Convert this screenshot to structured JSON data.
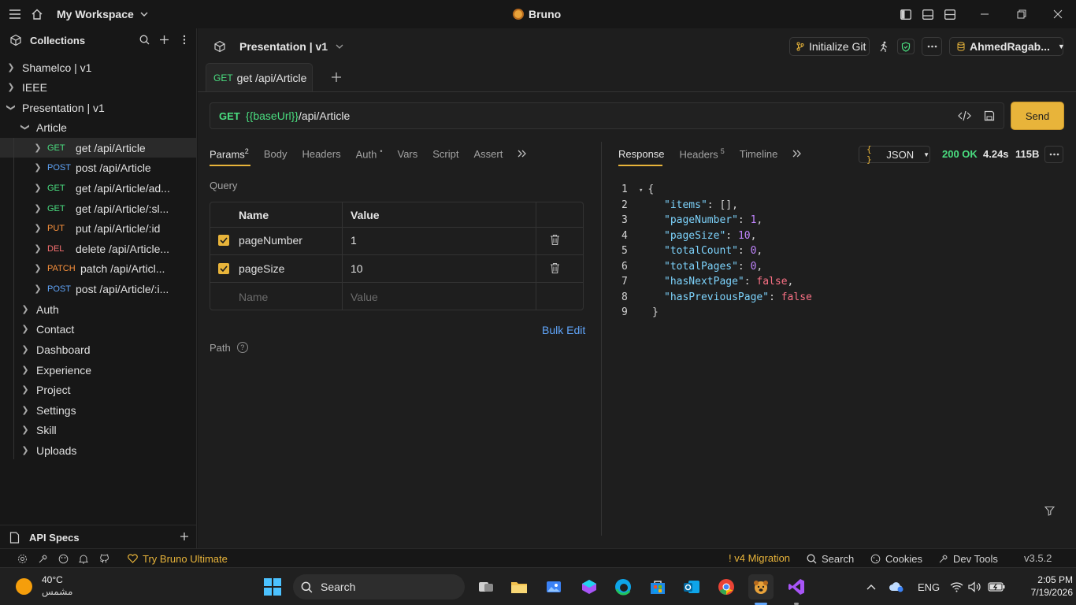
{
  "titlebar": {
    "workspace": "My Workspace",
    "app_name": "Bruno"
  },
  "sidebar": {
    "title": "Collections",
    "collections": [
      {
        "name": "Shamelco | v1",
        "expanded": false
      },
      {
        "name": "IEEE",
        "expanded": false
      },
      {
        "name": "Presentation | v1",
        "expanded": true
      }
    ],
    "folder_open": "Article",
    "requests": [
      {
        "method": "GET",
        "name": "get /api/Article"
      },
      {
        "method": "POST",
        "name": "post /api/Article"
      },
      {
        "method": "GET",
        "name": "get /api/Article/ad..."
      },
      {
        "method": "GET",
        "name": "get /api/Article/:sl..."
      },
      {
        "method": "PUT",
        "name": "put /api/Article/:id"
      },
      {
        "method": "DEL",
        "name": "delete /api/Article..."
      },
      {
        "method": "PATCH",
        "name": "patch /api/Articl..."
      },
      {
        "method": "POST",
        "name": "post /api/Article/:i..."
      }
    ],
    "folders": [
      "Auth",
      "Contact",
      "Dashboard",
      "Experience",
      "Project",
      "Settings",
      "Skill",
      "Uploads"
    ],
    "api_specs": "API Specs"
  },
  "header": {
    "collection_title": "Presentation | v1",
    "init_git": "Initialize Git",
    "environment": "AhmedRagab..."
  },
  "request_tab": {
    "method": "GET",
    "name": "get /api/Article"
  },
  "url_bar": {
    "method": "GET",
    "var": "{{baseUrl}}",
    "path": "/api/Article",
    "send": "Send"
  },
  "request_tabs": [
    {
      "label": "Params",
      "sup": "2"
    },
    {
      "label": "Body",
      "sup": ""
    },
    {
      "label": "Headers",
      "sup": ""
    },
    {
      "label": "Auth",
      "sup": "•"
    },
    {
      "label": "Vars",
      "sup": ""
    },
    {
      "label": "Script",
      "sup": ""
    },
    {
      "label": "Assert",
      "sup": ""
    }
  ],
  "params": {
    "query_label": "Query",
    "col_name": "Name",
    "col_value": "Value",
    "rows": [
      {
        "name": "pageNumber",
        "value": "1"
      },
      {
        "name": "pageSize",
        "value": "10"
      }
    ],
    "placeholder_name": "Name",
    "placeholder_value": "Value",
    "bulk_edit": "Bulk Edit",
    "path_label": "Path"
  },
  "response": {
    "tabs": [
      {
        "label": "Response",
        "sup": ""
      },
      {
        "label": "Headers",
        "sup": "5"
      },
      {
        "label": "Timeline",
        "sup": ""
      }
    ],
    "format": "JSON",
    "status": "200 OK",
    "time": "4.24s",
    "size": "115B",
    "lines": [
      {
        "n": "1",
        "key": "",
        "val": "{",
        "type": "p"
      },
      {
        "n": "2",
        "key": "\"items\"",
        "val": "[]",
        "type": "p"
      },
      {
        "n": "3",
        "key": "\"pageNumber\"",
        "val": "1",
        "type": "n"
      },
      {
        "n": "4",
        "key": "\"pageSize\"",
        "val": "10",
        "type": "n"
      },
      {
        "n": "5",
        "key": "\"totalCount\"",
        "val": "0",
        "type": "n"
      },
      {
        "n": "6",
        "key": "\"totalPages\"",
        "val": "0",
        "type": "n"
      },
      {
        "n": "7",
        "key": "\"hasNextPage\"",
        "val": "false",
        "type": "b"
      },
      {
        "n": "8",
        "key": "\"hasPreviousPage\"",
        "val": "false",
        "type": "b"
      },
      {
        "n": "9",
        "key": "",
        "val": "}",
        "type": "p"
      }
    ]
  },
  "statusbar": {
    "try_ultimate": "Try Bruno Ultimate",
    "migration": "! v4 Migration",
    "search": "Search",
    "cookies": "Cookies",
    "dev_tools": "Dev Tools",
    "version": "v3.5.2"
  },
  "taskbar": {
    "temp": "40°C",
    "weather": "مشمس",
    "search": "Search",
    "lang": "ENG",
    "time": "2:05 PM",
    "date": "7/19/2026"
  },
  "colors": {
    "accent": "#e8b43a",
    "get": "#4ade80",
    "post": "#60a5fa",
    "put": "#fb923c",
    "delete": "#f87171"
  }
}
